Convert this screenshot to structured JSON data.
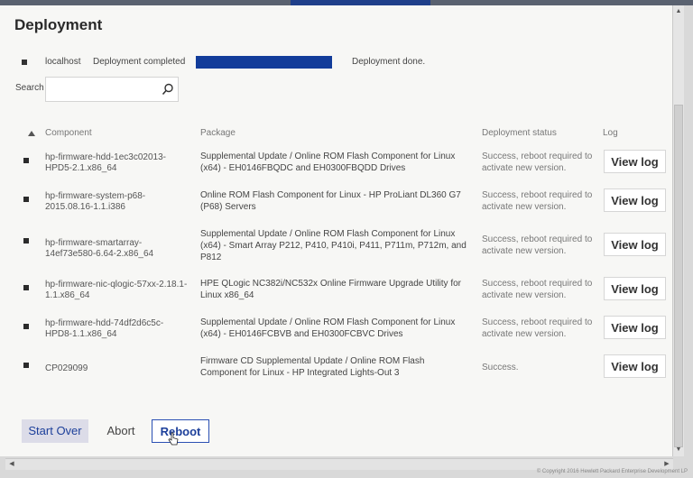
{
  "page": {
    "title": "Deployment"
  },
  "status": {
    "host": "localhost",
    "message": "Deployment completed",
    "progress_percent": 100,
    "done_text": "Deployment done."
  },
  "search": {
    "label": "Search",
    "value": "",
    "placeholder": ""
  },
  "table": {
    "headers": {
      "component": "Component",
      "package": "Package",
      "status": "Deployment status",
      "log": "Log"
    },
    "rows": [
      {
        "component": "hp-firmware-hdd-1ec3c02013-HPD5-2.1.x86_64",
        "package": "Supplemental Update / Online ROM Flash Component for Linux (x64) - EH0146FBQDC and EH0300FBQDD Drives",
        "status": "Success, reboot required to activate new version.",
        "log": "View log"
      },
      {
        "component": "hp-firmware-system-p68-2015.08.16-1.1.i386",
        "package": "Online ROM Flash Component for Linux - HP ProLiant DL360 G7 (P68) Servers",
        "status": "Success, reboot required to activate new version.",
        "log": "View log"
      },
      {
        "component": "hp-firmware-smartarray-14ef73e580-6.64-2.x86_64",
        "package": "Supplemental Update / Online ROM Flash Component for Linux (x64) - Smart Array P212, P410, P410i, P411, P711m, P712m, and P812",
        "status": "Success, reboot required to activate new version.",
        "log": "View log"
      },
      {
        "component": "hp-firmware-nic-qlogic-57xx-2.18.1-1.1.x86_64",
        "package": "HPE QLogic NC382i/NC532x Online Firmware Upgrade Utility for Linux x86_64",
        "status": "Success, reboot required to activate new version.",
        "log": "View log"
      },
      {
        "component": "hp-firmware-hdd-74df2d6c5c-HPD8-1.1.x86_64",
        "package": "Supplemental Update / Online ROM Flash Component for Linux (x64) - EH0146FCBVB and EH0300FCBVC Drives",
        "status": "Success, reboot required to activate new version.",
        "log": "View log"
      },
      {
        "component": "CP029099",
        "package": "Firmware CD Supplemental Update / Online ROM Flash Component for Linux - HP Integrated Lights-Out 3",
        "status": "Success.",
        "log": "View log"
      }
    ]
  },
  "actions": {
    "start_over": "Start Over",
    "abort": "Abort",
    "reboot": "Reboot"
  },
  "footer": {
    "copyright": "© Copyright 2016 Hewlett Packard Enterprise Development LP"
  },
  "colors": {
    "accent": "#123c9a",
    "progress": "#123c9a"
  }
}
